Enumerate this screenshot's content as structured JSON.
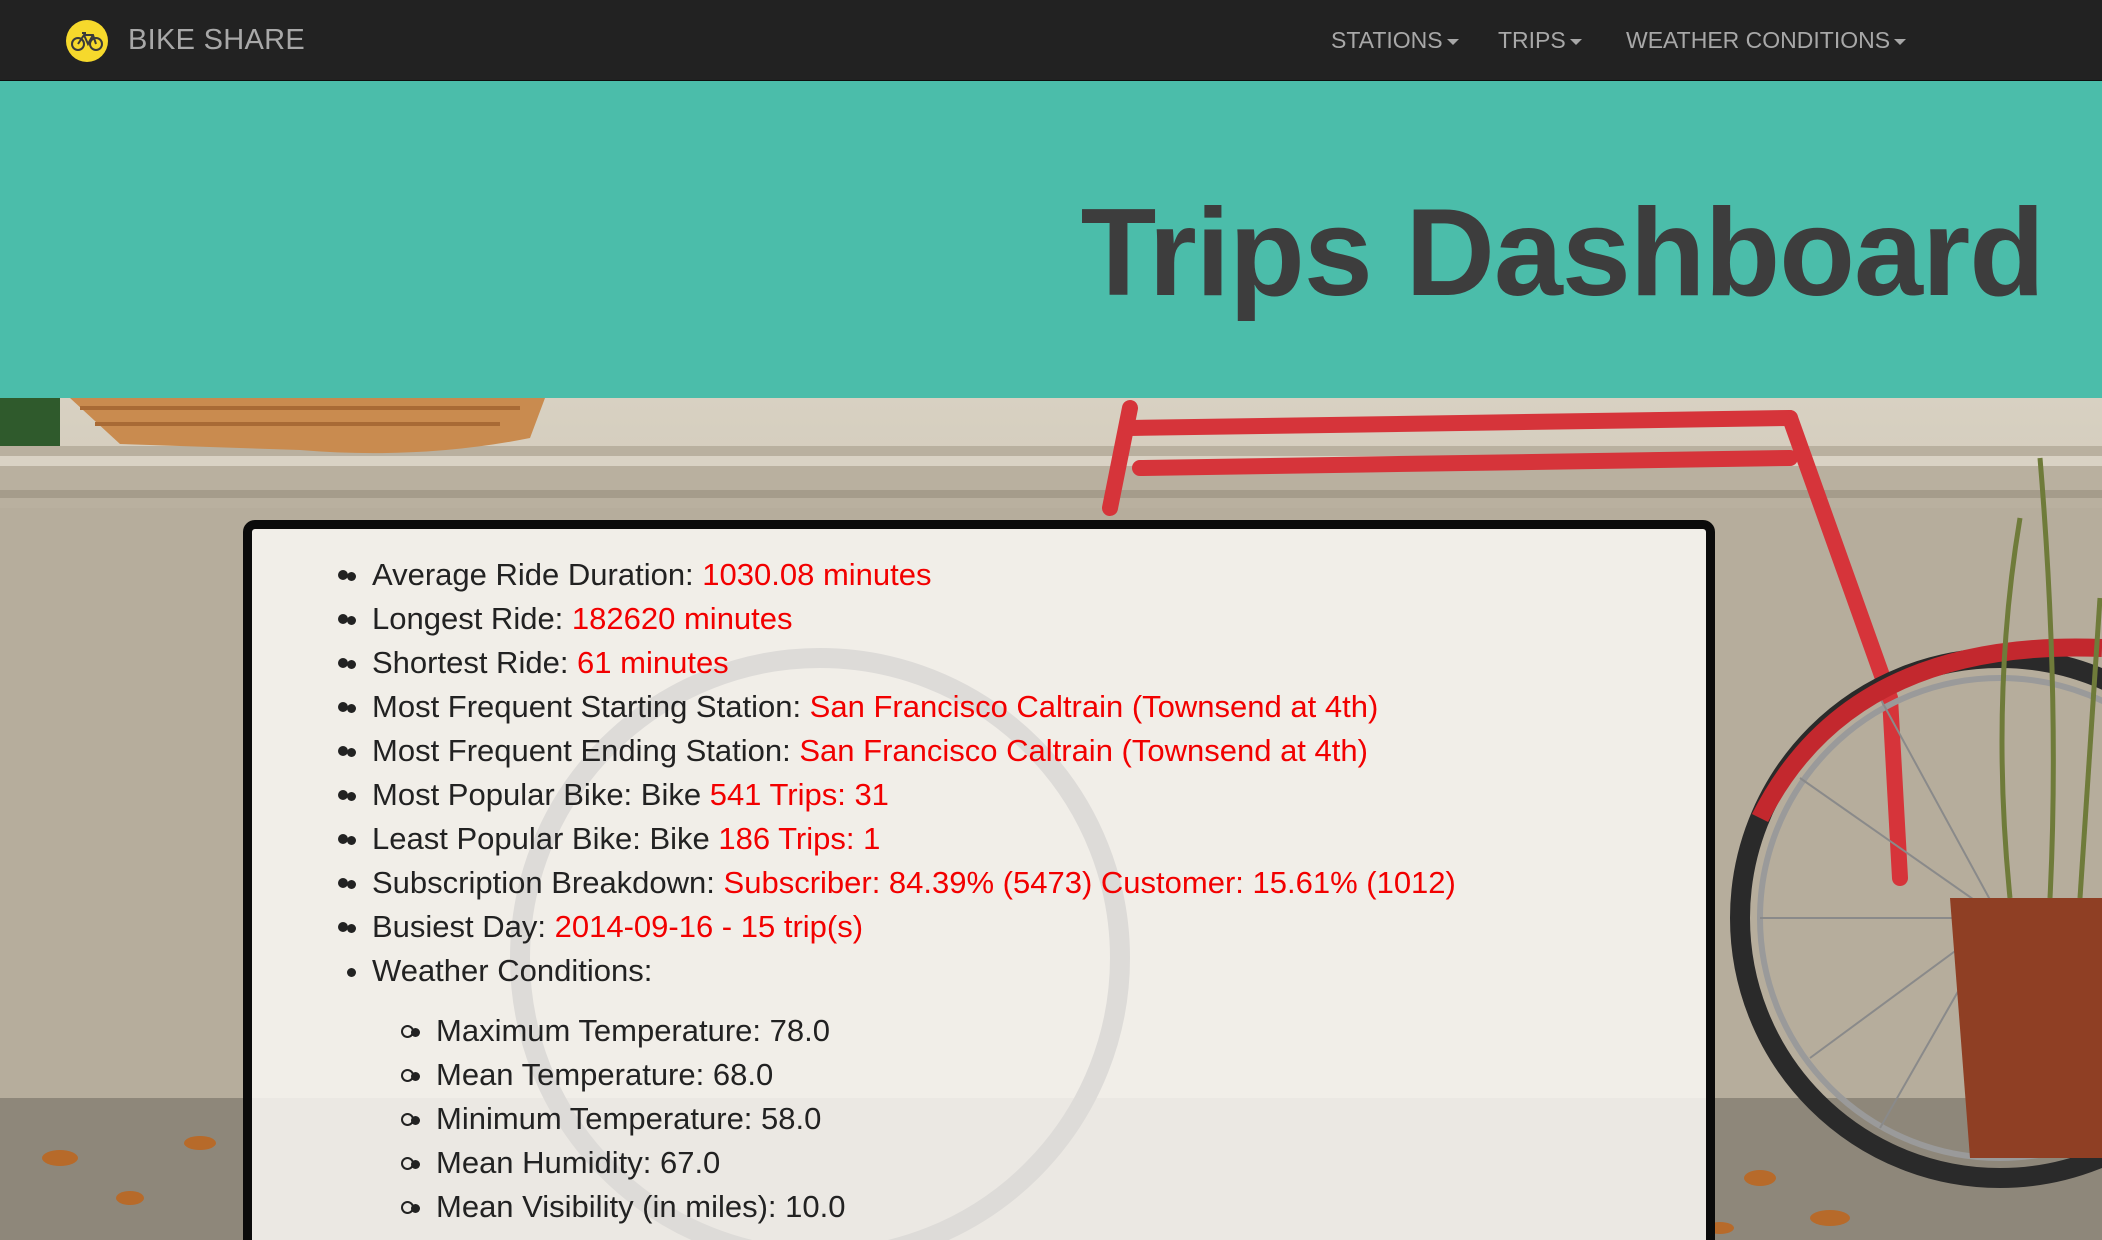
{
  "navbar": {
    "brand": "BIKE SHARE",
    "logo_icon": "bicycle-icon",
    "items": [
      {
        "label": "STATIONS"
      },
      {
        "label": "TRIPS"
      },
      {
        "label": "WEATHER CONDITIONS"
      }
    ]
  },
  "header": {
    "title": "Trips Dashboard",
    "background_color": "#4bbdaa"
  },
  "stats": [
    {
      "label": "Average Ride Duration: ",
      "value": "1030.08 minutes"
    },
    {
      "label": "Longest Ride: ",
      "value": "182620 minutes"
    },
    {
      "label": "Shortest Ride: ",
      "value": "61 minutes"
    },
    {
      "label": "Most Frequent Starting Station: ",
      "value": "San Francisco Caltrain (Townsend at 4th)"
    },
    {
      "label": "Most Frequent Ending Station: ",
      "value": "San Francisco Caltrain (Townsend at 4th)"
    },
    {
      "label": "Most Popular Bike: Bike ",
      "value": "541 Trips: 31"
    },
    {
      "label": "Least Popular Bike: Bike ",
      "value": "186 Trips: 1"
    },
    {
      "label": "Subscription Breakdown: ",
      "value": "Subscriber: 84.39% (5473) Customer: 15.61% (1012)"
    },
    {
      "label": "Busiest Day: ",
      "value": "2014-09-16 - 15 trip(s)"
    }
  ],
  "weather": {
    "heading": "Weather Conditions:",
    "items": [
      "Maximum Temperature: 78.0",
      "Mean Temperature: 68.0",
      "Minimum Temperature: 58.0",
      "Mean Humidity: 67.0",
      "Mean Visibility (in miles): 10.0"
    ]
  },
  "colors": {
    "value_text": "#f20000",
    "navbar_bg": "#222222",
    "title_text": "#3d3d3d",
    "logo_bg": "#f6d92c"
  }
}
